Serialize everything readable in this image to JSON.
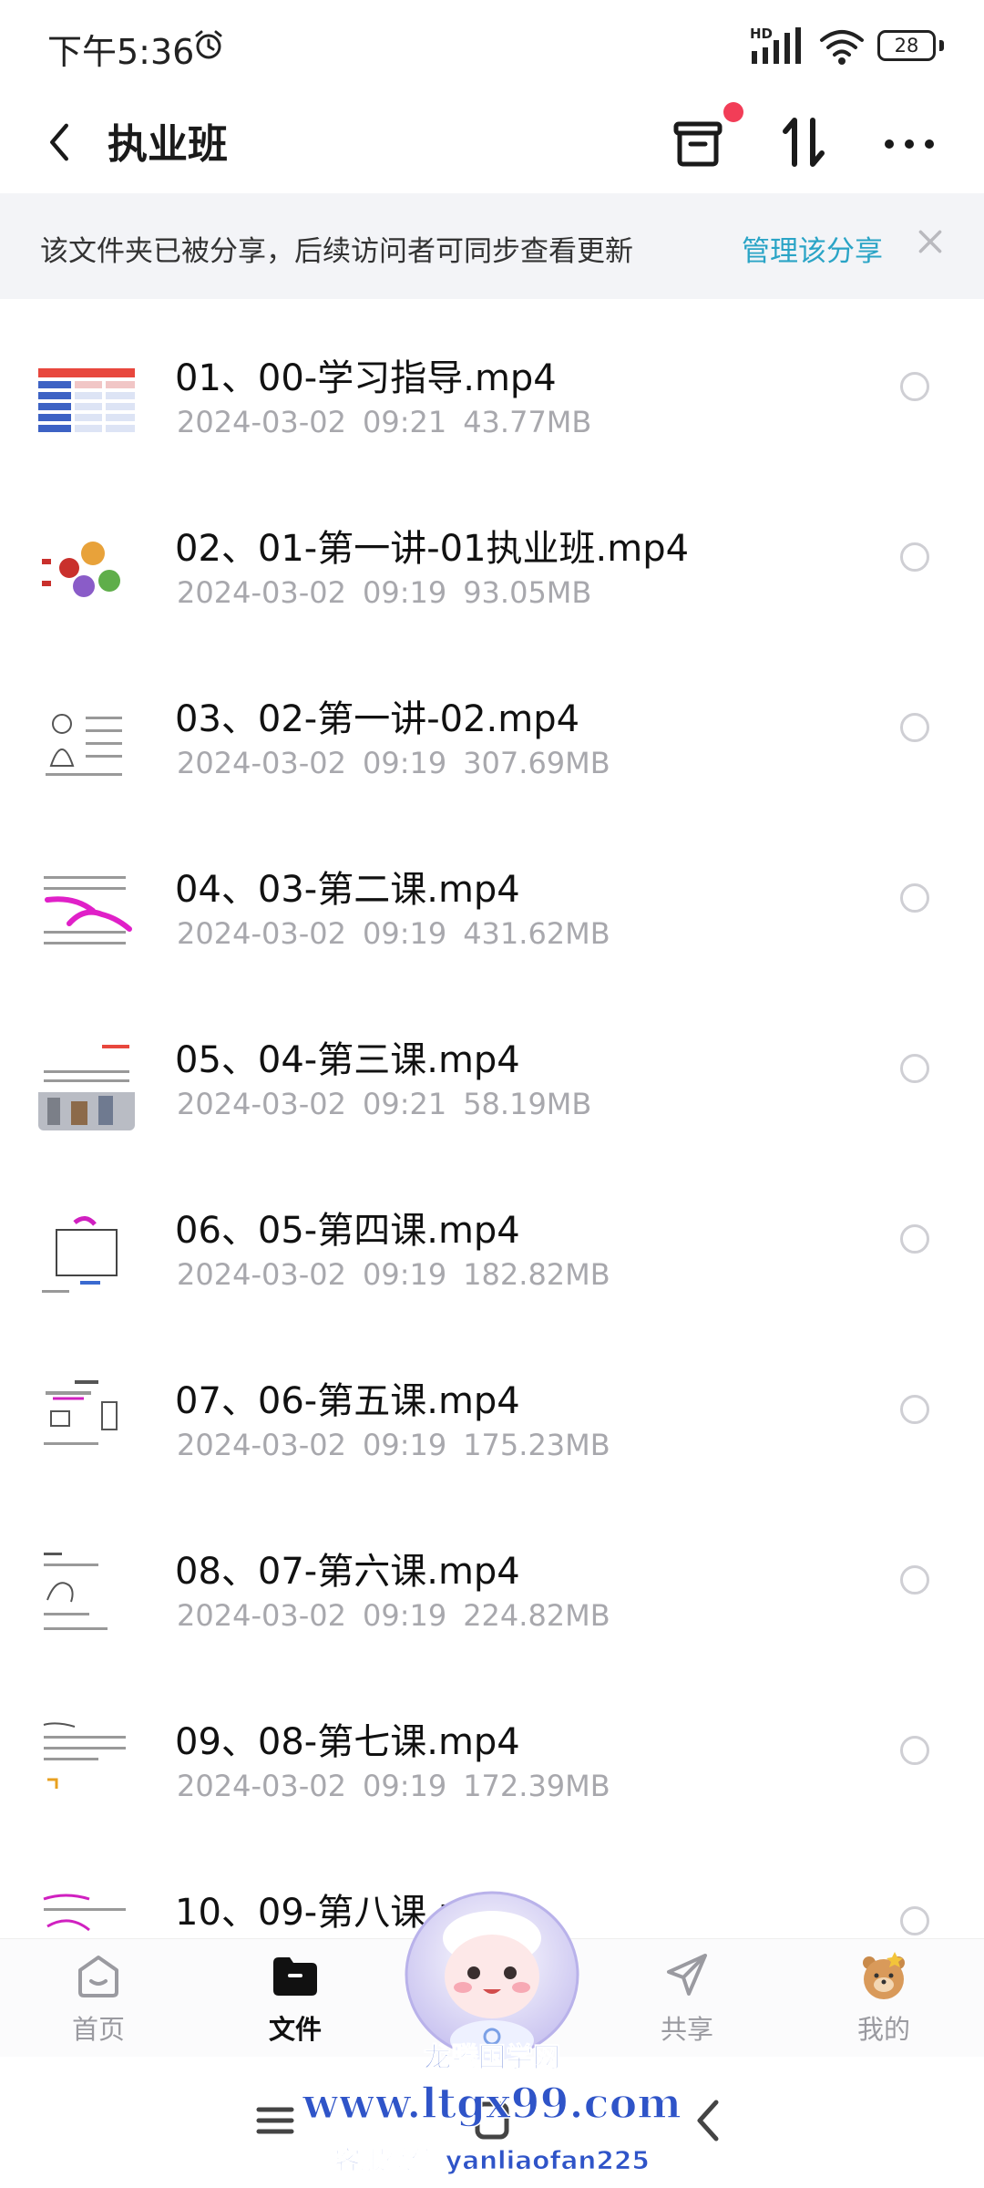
{
  "status_bar": {
    "time": "下午5:36",
    "network": "HD",
    "battery": "28",
    "icons": [
      "alarm-icon",
      "signal-icon",
      "wifi-icon",
      "battery-icon"
    ]
  },
  "header": {
    "title": "执业班",
    "icons": [
      "back-icon",
      "archive-icon",
      "sort-icon",
      "more-icon"
    ]
  },
  "share_banner": {
    "text": "该文件夹已被分享，后续访问者可同步查看更新",
    "manage_label": "管理该分享"
  },
  "files": [
    {
      "name": "01、00-学习指导.mp4",
      "date": "2024-03-02",
      "time": "09:21",
      "size": "43.77MB"
    },
    {
      "name": "02、01-第一讲-01执业班.mp4",
      "date": "2024-03-02",
      "time": "09:19",
      "size": "93.05MB"
    },
    {
      "name": "03、02-第一讲-02.mp4",
      "date": "2024-03-02",
      "time": "09:19",
      "size": "307.69MB"
    },
    {
      "name": "04、03-第二课.mp4",
      "date": "2024-03-02",
      "time": "09:19",
      "size": "431.62MB"
    },
    {
      "name": "05、04-第三课.mp4",
      "date": "2024-03-02",
      "time": "09:21",
      "size": "58.19MB"
    },
    {
      "name": "06、05-第四课.mp4",
      "date": "2024-03-02",
      "time": "09:19",
      "size": "182.82MB"
    },
    {
      "name": "07、06-第五课.mp4",
      "date": "2024-03-02",
      "time": "09:19",
      "size": "175.23MB"
    },
    {
      "name": "08、07-第六课.mp4",
      "date": "2024-03-02",
      "time": "09:19",
      "size": "224.82MB"
    },
    {
      "name": "09、08-第七课.mp4",
      "date": "2024-03-02",
      "time": "09:19",
      "size": "172.39MB"
    },
    {
      "name": "10、09-第八课.m",
      "date": "",
      "time": "",
      "size": ""
    }
  ],
  "bottom_nav": {
    "items": [
      {
        "label": "首页",
        "icon": "home-icon"
      },
      {
        "label": "文件",
        "icon": "folder-icon",
        "active": true
      },
      {
        "label": "共享",
        "icon": "share-icon"
      },
      {
        "label": "我的",
        "icon": "profile-icon"
      }
    ]
  },
  "watermark": {
    "line1": "龙腾国学网",
    "line2": "www.ltgx99.com",
    "line3": "客服微信 yanliaofan225"
  },
  "colors": {
    "accent_link": "#2aa4c6",
    "notification_dot": "#f23d57",
    "meta_text": "#a8a8ad",
    "banner_bg": "#f3f4f7",
    "watermark_blue": "#2f54c8"
  }
}
